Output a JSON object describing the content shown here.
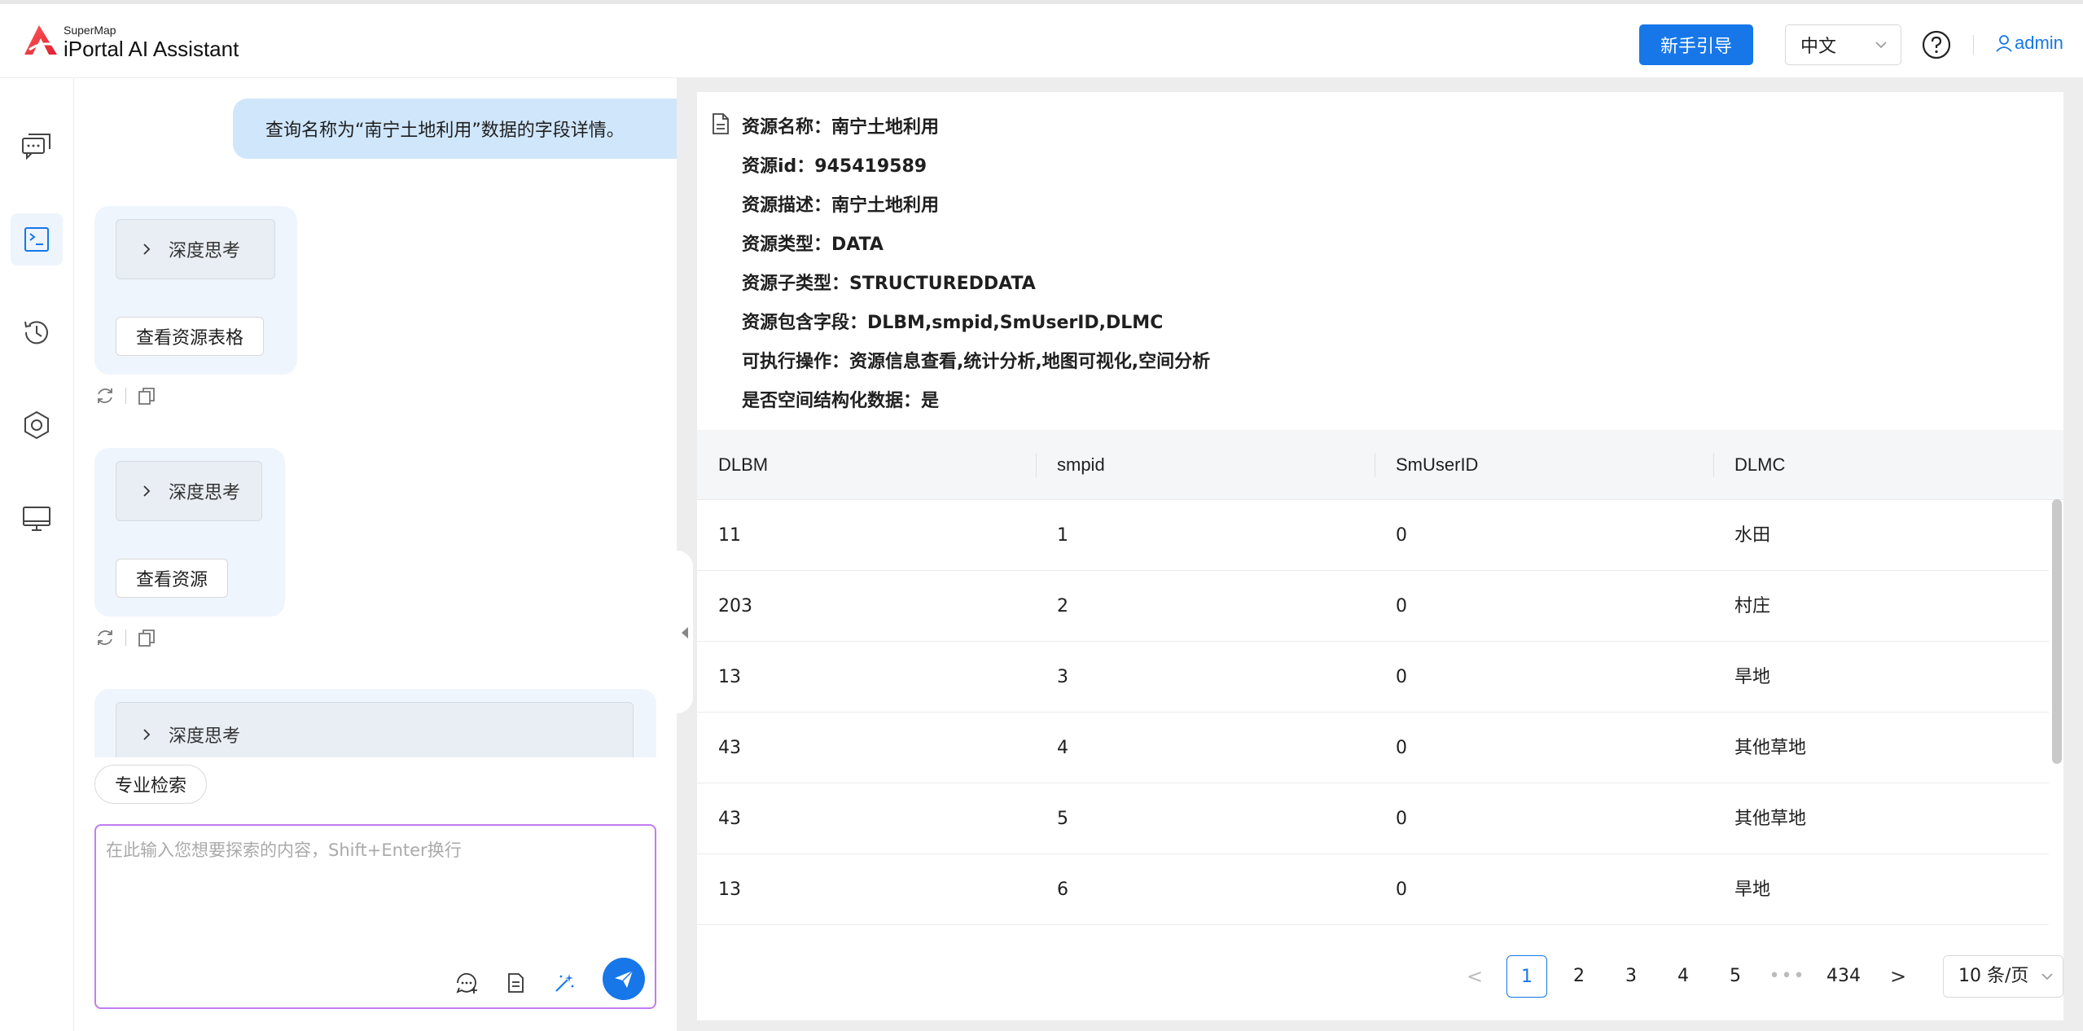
{
  "header": {
    "logo_small": "SuperMap",
    "logo_big": "iPortal AI Assistant",
    "guide_button": "新手引导",
    "language": "中文",
    "user": "admin"
  },
  "chat": {
    "user_message": "查询名称为“南宁土地利用”数据的字段详情。",
    "cards": [
      {
        "think_label": "深度思考",
        "button_label": "查看资源表格"
      },
      {
        "think_label": "深度思考",
        "button_label": "查看资源"
      },
      {
        "think_label": "深度思考"
      }
    ],
    "pro_search_label": "专业检索",
    "input_placeholder": "在此输入您想要探索的内容，Shift+Enter换行"
  },
  "resource": {
    "lines": [
      "资源名称：南宁土地利用",
      "资源id：945419589",
      "资源描述：南宁土地利用",
      "资源类型：DATA",
      "资源子类型：STRUCTUREDDATA",
      "资源包含字段：DLBM,smpid,SmUserID,DLMC",
      "可执行操作：资源信息查看,统计分析,地图可视化,空间分析",
      "是否空间结构化数据：是"
    ]
  },
  "table": {
    "columns": [
      "DLBM",
      "smpid",
      "SmUserID",
      "DLMC"
    ],
    "rows": [
      [
        "11",
        "1",
        "0",
        "水田"
      ],
      [
        "203",
        "2",
        "0",
        "村庄"
      ],
      [
        "13",
        "3",
        "0",
        "旱地"
      ],
      [
        "43",
        "4",
        "0",
        "其他草地"
      ],
      [
        "43",
        "5",
        "0",
        "其他草地"
      ],
      [
        "13",
        "6",
        "0",
        "旱地"
      ]
    ]
  },
  "pagination": {
    "prev": "<",
    "pages": [
      "1",
      "2",
      "3",
      "4",
      "5"
    ],
    "dots": "•••",
    "last": "434",
    "next": ">",
    "current": "1",
    "page_size": "10 条/页"
  },
  "colors": {
    "accent": "#1777e8",
    "user_bubble": "#cfe6fb",
    "ai_card": "#eff5fc",
    "input_border": "#c37cf0"
  }
}
